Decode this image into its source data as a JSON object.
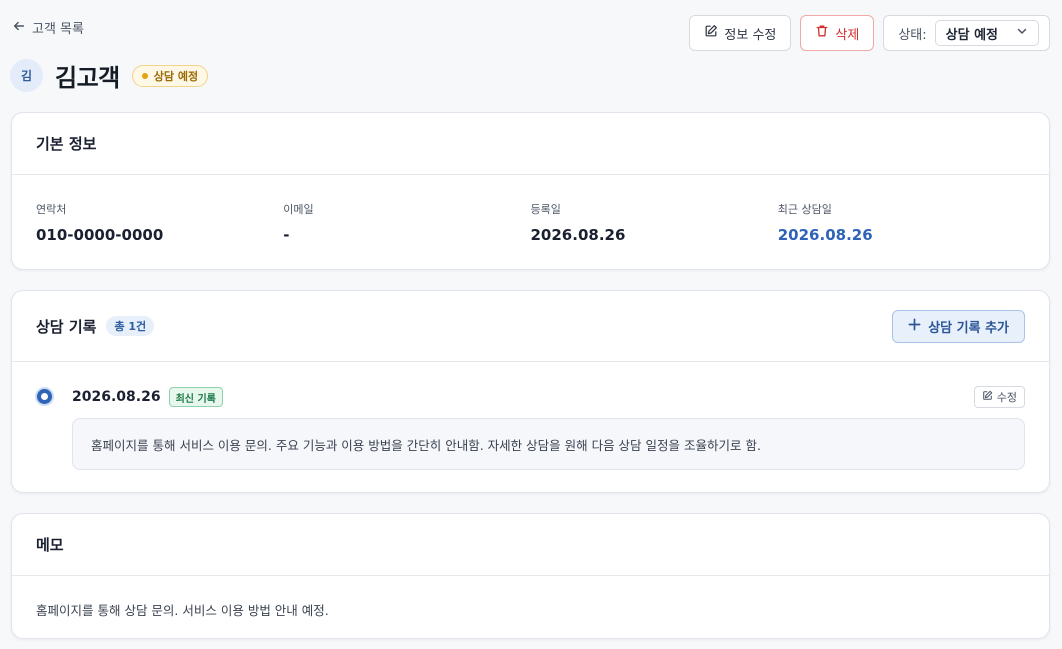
{
  "back": {
    "label": "고객 목록"
  },
  "customer": {
    "avatar": "김",
    "name": "김고객",
    "status": "상담 예정"
  },
  "actions": {
    "edit_label": "정보 수정",
    "delete_label": "삭제",
    "status_label": "상태:",
    "status_value": "상담 예정"
  },
  "basic_info": {
    "title": "기본 정보",
    "fields": [
      {
        "label": "연락처",
        "value": "010-0000-0000"
      },
      {
        "label": "이메일",
        "value": "-"
      },
      {
        "label": "등록일",
        "value": "2026.08.26"
      },
      {
        "label": "최근 상담일",
        "value": "2026.08.26"
      }
    ]
  },
  "records": {
    "title": "상담 기록",
    "count": "총 1건",
    "add_label": "상담 기록 추가",
    "items": [
      {
        "date": "2026.08.26",
        "badge": "최신 기록",
        "edit_label": "수정",
        "content": "홈페이지를 통해 서비스 이용 문의. 주요 기능과 이용 방법을 간단히 안내함. 자세한 상담을 원해 다음 상담 일정을 조율하기로 함."
      }
    ]
  },
  "memo": {
    "title": "메모",
    "content": "홈페이지를 통해 상담 문의. 서비스 이용 방법 안내 예정."
  },
  "colors": {
    "accent": "#2e63b8",
    "danger": "#d32f2f",
    "warning": "#e2a310",
    "success": "#1b7a47"
  },
  "icons": {
    "back": "arrow-left-icon",
    "edit": "pencil-square-icon",
    "delete": "trash-icon",
    "dropdown": "chevron-down-icon",
    "add": "plus-icon"
  }
}
